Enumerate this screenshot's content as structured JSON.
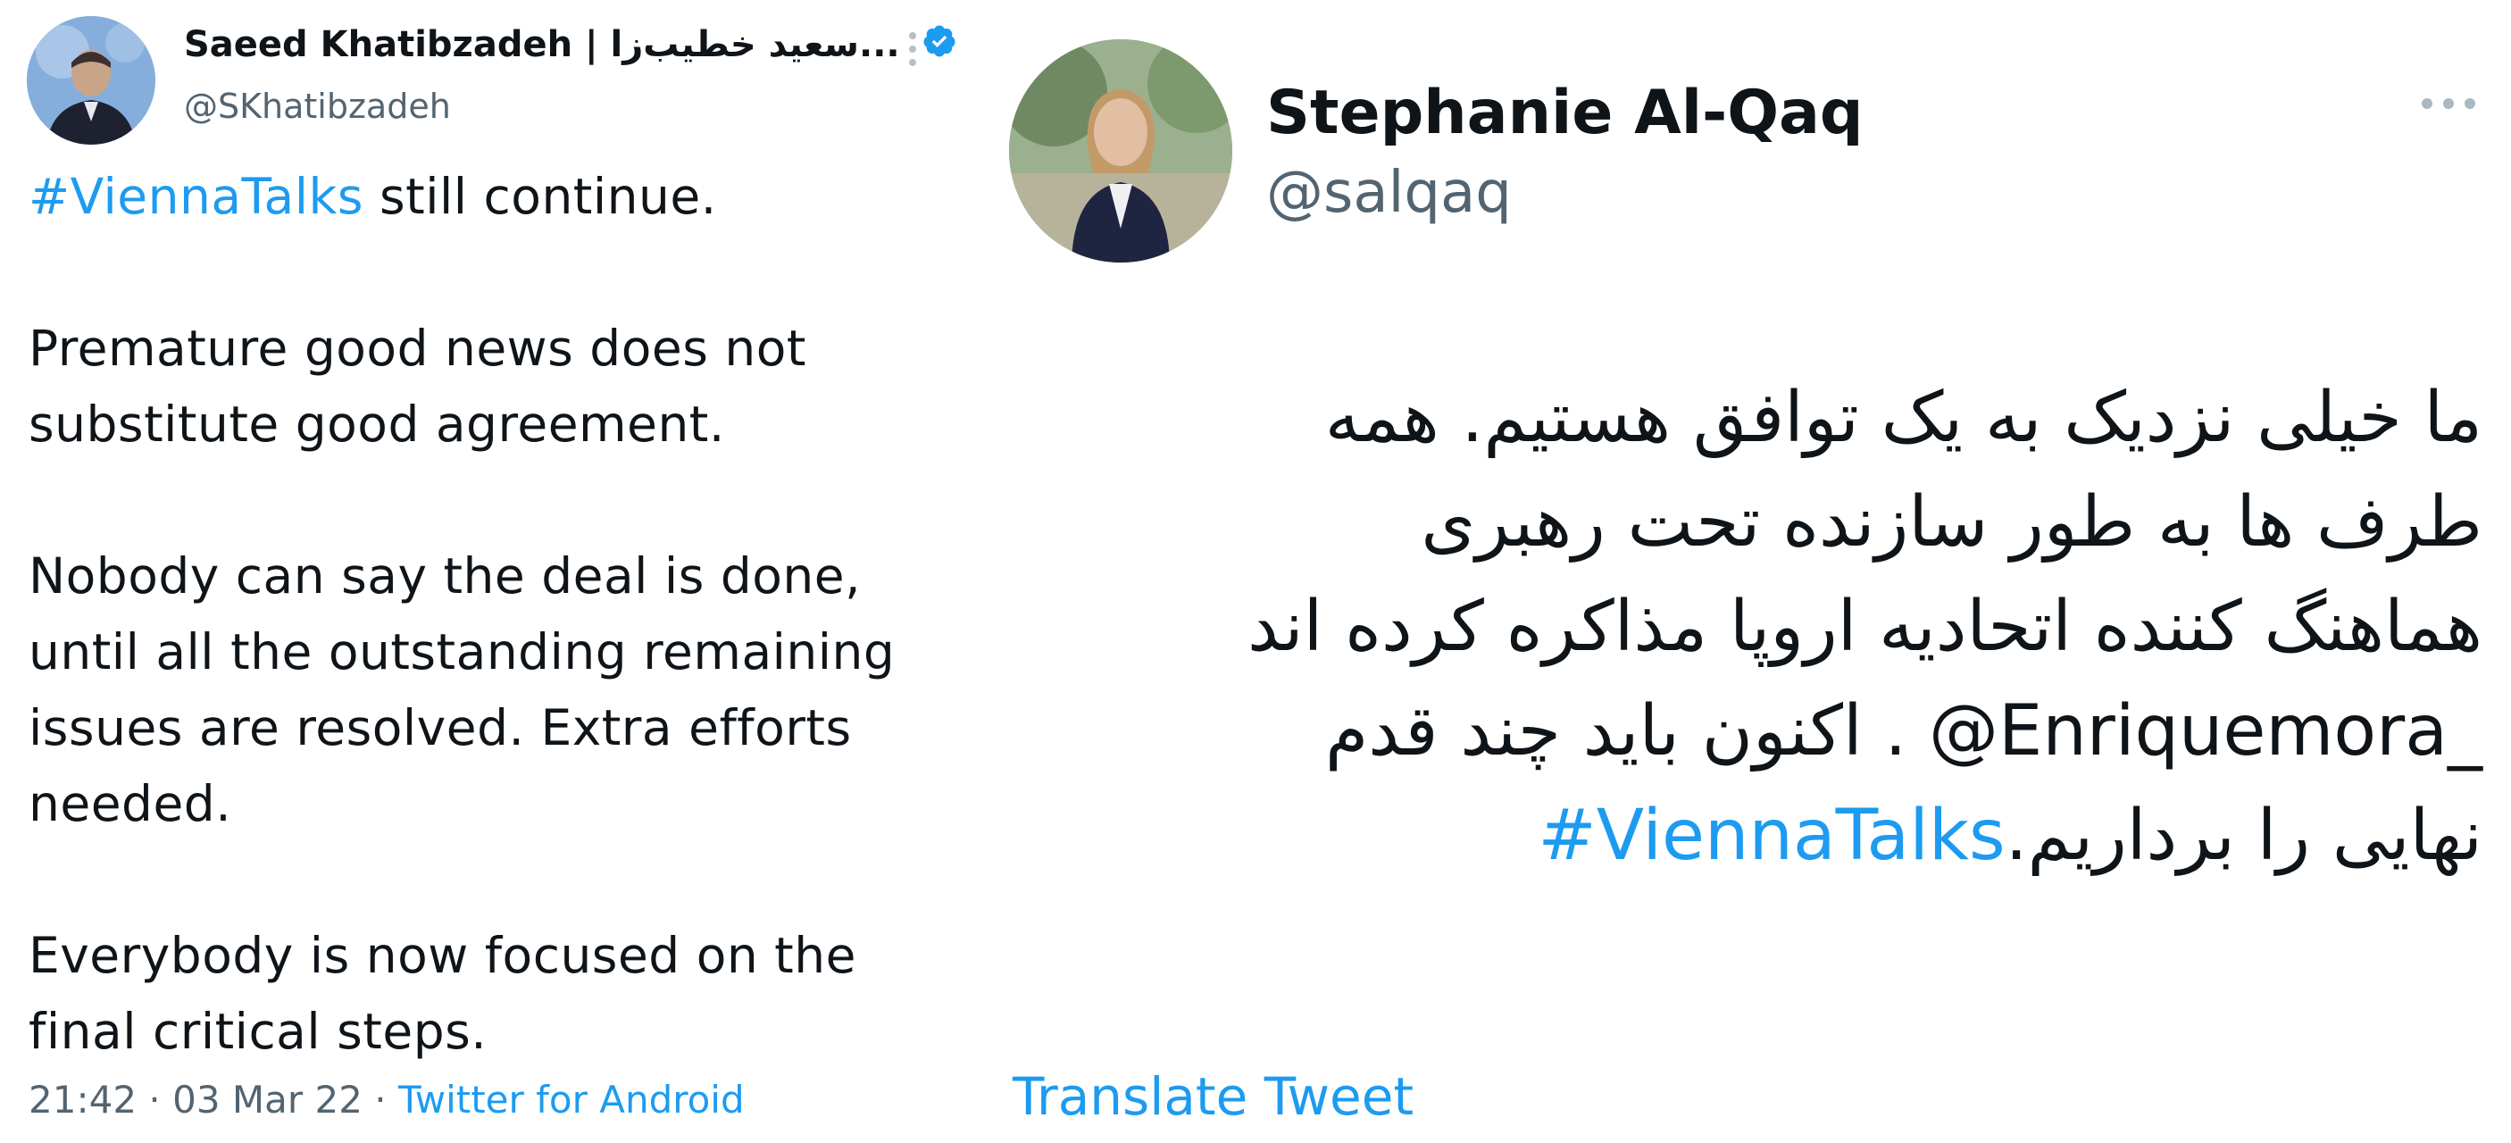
{
  "left_tweet": {
    "display_name": "Saeed Khatibzadeh | سعید خطیب‌زا...",
    "handle": "@SKhatibzadeh",
    "body": {
      "line1_hashtag": "#ViennaTalks",
      "line1_rest": " still continue.",
      "para2": "Premature good news does not substitute good agreement.",
      "para3": "Nobody can say the deal is done, until all the outstanding remaining issues are resolved. Extra efforts needed.",
      "para4": "Everybody is now focused on the final critical steps."
    },
    "time": "21:42",
    "separator": " · ",
    "date": "03 Mar 22",
    "source": "Twitter for Android",
    "verified_color": "#1d9bf0"
  },
  "right_tweet": {
    "display_name": "Stephanie Al-Qaq",
    "handle": "@salqaq",
    "body_lines": {
      "l1": "ما خیلی نزدیک به یک توافق هستیم. همه",
      "l2": "طرف ها به طور سازنده تحت رهبری",
      "l3": "هماهنگ کننده اتحادیه اروپا مذاکره کرده اند",
      "l4_mention": "@Enriquemora_",
      "l4_rest": " . اکنون باید چند قدم",
      "l5_text": "نهایی را برداریم.",
      "l5_hashtag": "#ViennaTalks"
    },
    "translate_label": "Translate Tweet"
  },
  "colors": {
    "link": "#1d9bf0",
    "secondary_text": "#536471",
    "primary_text": "#0f1419"
  },
  "icons": {
    "verified": "verified-badge-icon",
    "more": "more-options-icon"
  }
}
